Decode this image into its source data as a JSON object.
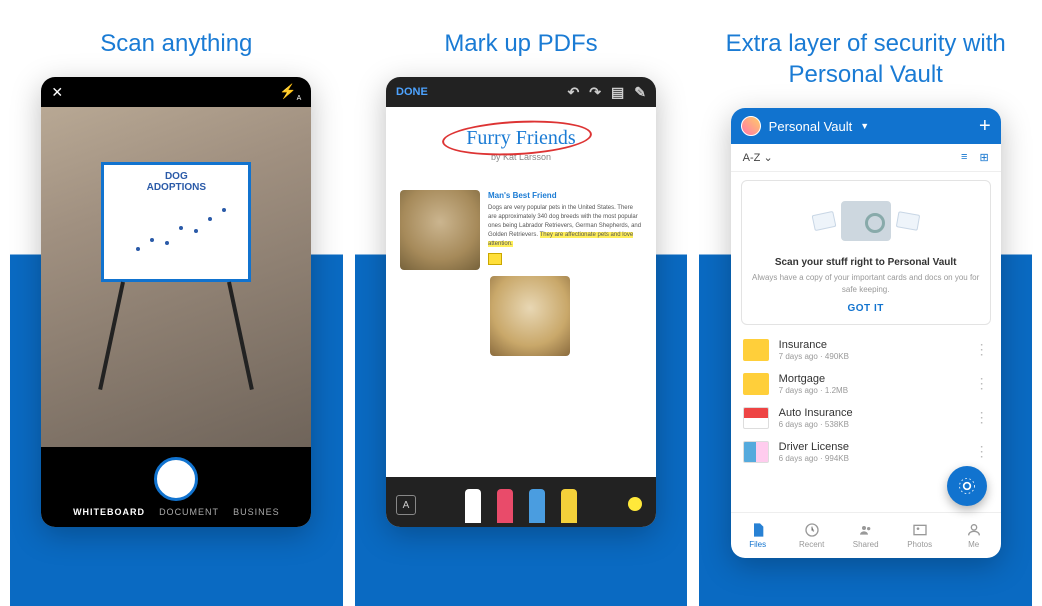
{
  "panels": {
    "scan": {
      "title": "Scan anything",
      "board_line1": "DOG",
      "board_line2": "ADOPTIONS",
      "modes": {
        "whiteboard": "WHITEBOARD",
        "document": "DOCUMENT",
        "business": "BUSINES"
      }
    },
    "markup": {
      "title": "Mark up PDFs",
      "done": "DONE",
      "doc_title": "Furry Friends",
      "doc_subtitle": "by Kat Larsson",
      "article_heading": "Man's Best Friend",
      "article_body": "Dogs are very popular pets in the United States. There are approximately 340 dog breeds with the most popular ones being Labrador Retrievers, German Shepherds, and Golden Retrievers.",
      "article_highlight": "They are affectionate pets and love attention."
    },
    "vault": {
      "title": "Extra layer of security with Personal Vault",
      "header": "Personal Vault",
      "sort": "A-Z",
      "promo_heading": "Scan your stuff right to Personal Vault",
      "promo_sub": "Always have a copy of your important cards and docs on you for safe keeping.",
      "promo_cta": "GOT IT",
      "files": [
        {
          "name": "Insurance",
          "meta": "7 days ago · 490KB",
          "kind": "folder"
        },
        {
          "name": "Mortgage",
          "meta": "7 days ago · 1.2MB",
          "kind": "folder"
        },
        {
          "name": "Auto Insurance",
          "meta": "6 days ago · 538KB",
          "kind": "pdf"
        },
        {
          "name": "Driver License",
          "meta": "6 days ago · 994KB",
          "kind": "card"
        }
      ],
      "nav": {
        "files": "Files",
        "recent": "Recent",
        "shared": "Shared",
        "photos": "Photos",
        "me": "Me"
      }
    }
  }
}
